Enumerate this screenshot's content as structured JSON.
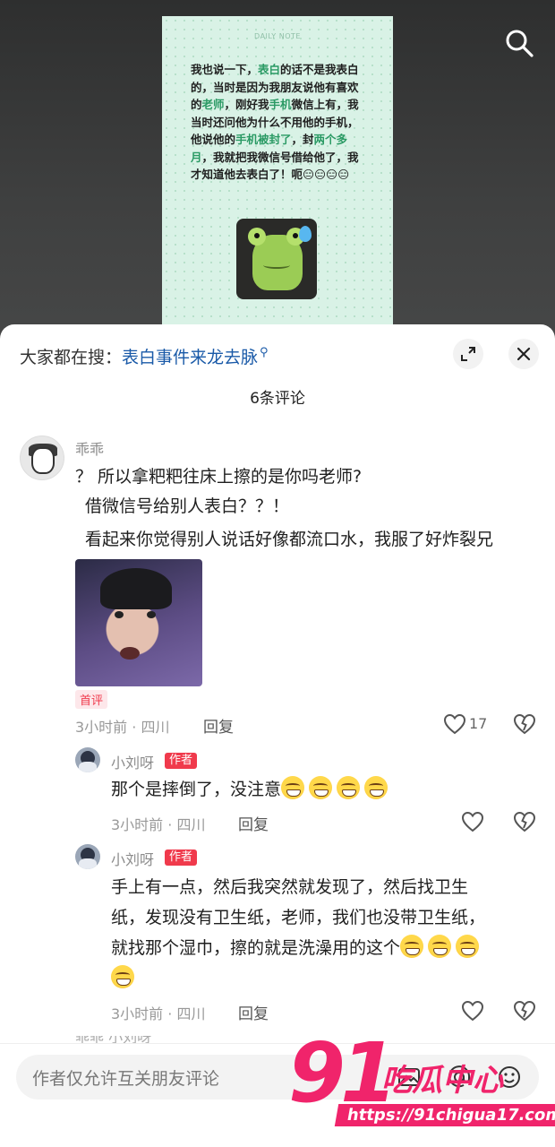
{
  "note": {
    "header": "DAILY NOTE",
    "segments": [
      {
        "t": "我也说一下，",
        "hl": false
      },
      {
        "t": "表白",
        "hl": true
      },
      {
        "t": "的话不是我表白的，当时是因为我朋友说他有喜欢的",
        "hl": false
      },
      {
        "t": "老师",
        "hl": true
      },
      {
        "t": "，刚好我",
        "hl": false
      },
      {
        "t": "手机",
        "hl": true
      },
      {
        "t": "微信上有，我当时还问他为什么不用他的手机，他说他的",
        "hl": false
      },
      {
        "t": "手机被封了",
        "hl": true
      },
      {
        "t": "，封",
        "hl": false
      },
      {
        "t": "两个多月",
        "hl": true
      },
      {
        "t": "，我就把我微信号借给他了，我才知道他去表白了！呃😑😑😑😑",
        "hl": false
      }
    ]
  },
  "sheet": {
    "hot_search_prefix": "大家都在搜：",
    "hot_search_keyword": "表白事件来龙去脉",
    "comment_count": "6条评论"
  },
  "comments": {
    "main": {
      "username": "乖乖",
      "lines": [
        "？ 所以拿粑粑往床上擦的是你吗老师?",
        "借微信号给别人表白？？！",
        "看起来你觉得别人说话好像都流口水，我服了好炸裂兄"
      ],
      "first_badge": "首评",
      "meta": "3小时前 · 四川",
      "reply": "回复",
      "likes": "17"
    },
    "reply1": {
      "username": "小刘呀",
      "badge": "作者",
      "text": "那个是摔倒了，没注意",
      "meta": "3小时前 · 四川",
      "reply": "回复"
    },
    "reply2": {
      "username": "小刘呀",
      "badge": "作者",
      "lines": [
        "手上有一点，然后我突然就发现了，然后找卫生",
        "纸，发现没有卫生纸，老师，我们也没带卫生纸，",
        "就找那个湿巾，擦的就是洗澡用的这个"
      ],
      "meta": "3小时前 · 四川",
      "reply": "回复"
    },
    "cutoff_text": "乖乖 小刘呀"
  },
  "input": {
    "placeholder": "作者仅允许互关朋友评论"
  },
  "watermark": {
    "number": "91",
    "cn": "吃瓜中心",
    "url": "https://91chigua17.com"
  },
  "colors": {
    "accent": "#f03a4c",
    "link": "#1a5aa8",
    "highlight": "#2a9a64",
    "watermark": "#f0246b"
  }
}
